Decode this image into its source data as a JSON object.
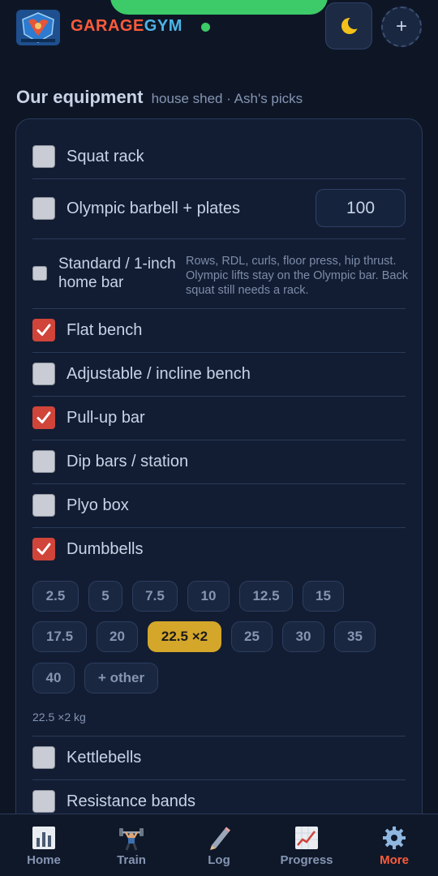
{
  "header": {
    "brand_part1": "GARAGE",
    "brand_part2": "GYM",
    "status": "online",
    "theme_icon": "moon-icon",
    "add_label": "+"
  },
  "section": {
    "title": "Our equipment",
    "subtitle": "house shed · Ash's picks"
  },
  "equipment": {
    "squat_rack": {
      "label": "Squat rack",
      "checked": false
    },
    "olympic_barbell": {
      "label": "Olympic barbell + plates",
      "checked": false,
      "weight_value": "100"
    },
    "standard_bar": {
      "label": "Standard / 1-inch home bar",
      "checked": false,
      "note": "Rows, RDL, curls, floor press, hip thrust. Olympic lifts stay on the Olympic bar. Back squat still needs a rack."
    },
    "flat_bench": {
      "label": "Flat bench",
      "checked": true
    },
    "adjustable_bench": {
      "label": "Adjustable / incline bench",
      "checked": false
    },
    "pullup_bar": {
      "label": "Pull-up bar",
      "checked": true
    },
    "dip_bars": {
      "label": "Dip bars / station",
      "checked": false
    },
    "plyo_box": {
      "label": "Plyo box",
      "checked": false
    },
    "dumbbells": {
      "label": "Dumbbells",
      "checked": true
    },
    "kettlebells": {
      "label": "Kettlebells",
      "checked": false
    },
    "resistance_bands": {
      "label": "Resistance bands",
      "checked": false
    }
  },
  "dumbbell_weights": {
    "chips": [
      "2.5",
      "5",
      "7.5",
      "10",
      "12.5",
      "15",
      "17.5",
      "20",
      "22.5 ×2",
      "25",
      "30",
      "35",
      "40",
      "+ other"
    ],
    "selected": "22.5 ×2",
    "summary": "22.5 ×2 kg"
  },
  "nav": {
    "items": [
      {
        "label": "Home",
        "icon": "bar-chart-icon"
      },
      {
        "label": "Train",
        "icon": "weightlifter-icon"
      },
      {
        "label": "Log",
        "icon": "pencil-icon"
      },
      {
        "label": "Progress",
        "icon": "trending-up-icon"
      },
      {
        "label": "More",
        "icon": "gear-icon"
      }
    ],
    "active": "More"
  },
  "colors": {
    "accent": "#ff5b3a",
    "brand_blue": "#4cb4e6",
    "checked": "#d0443a",
    "selected_chip": "#d4a62a",
    "online": "#3ccb68"
  }
}
